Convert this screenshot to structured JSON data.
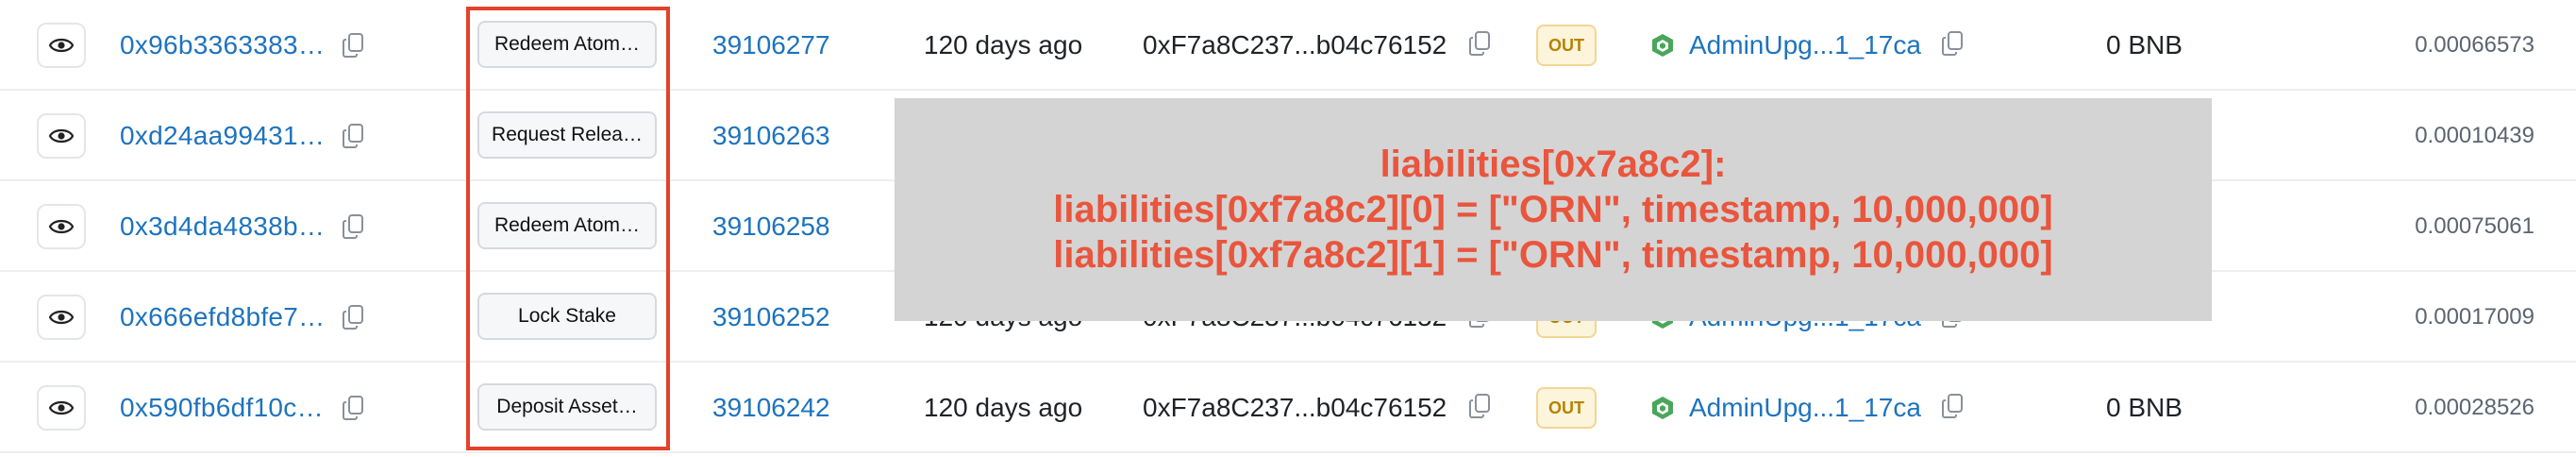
{
  "rows": [
    {
      "hash": "0x96b3363383…",
      "method": "Redeem Atom…",
      "block": "39106277",
      "age": "120 days ago",
      "from": "0xF7a8C237...b04c76152",
      "direction": "OUT",
      "to": "AdminUpg...1_17ca",
      "value": "0 BNB",
      "fee": "0.00066573"
    },
    {
      "hash": "0xd24aa99431…",
      "method": "Request Relea…",
      "block": "39106263",
      "age": "",
      "from": "",
      "direction": "",
      "to": "",
      "value": "",
      "fee": "0.00010439"
    },
    {
      "hash": "0x3d4da4838b…",
      "method": "Redeem Atom…",
      "block": "39106258",
      "age": "",
      "from": "",
      "direction": "",
      "to": "",
      "value": "",
      "fee": "0.00075061"
    },
    {
      "hash": "0x666efd8bfe7…",
      "method": "Lock Stake",
      "block": "39106252",
      "age": "120 days ago",
      "from": "0xF7a8C237...b04c76152",
      "direction": "OUT",
      "to": "AdminUpg...1_17ca",
      "value": "",
      "fee": "0.00017009"
    },
    {
      "hash": "0x590fb6df10c…",
      "method": "Deposit Asset…",
      "block": "39106242",
      "age": "120 days ago",
      "from": "0xF7a8C237...b04c76152",
      "direction": "OUT",
      "to": "AdminUpg...1_17ca",
      "value": "0 BNB",
      "fee": "0.00028526"
    }
  ],
  "overlay": {
    "line1": "liabilities[0x7a8c2]:",
    "line2": "liabilities[0xf7a8c2][0] = [\"ORN\", timestamp, 10,000,000]",
    "line3": "liabilities[0xf7a8c2][1] = [\"ORN\", timestamp, 10,000,000]"
  },
  "icons": {
    "view": "eye-icon",
    "copy": "copy-icon",
    "contract": "contract-icon"
  },
  "colors": {
    "link": "#1e73be",
    "annotation": "#e9553d",
    "highlight_border": "#e4412c",
    "badge_bg": "#fdf4dc",
    "badge_text": "#b58300",
    "overlay_bg": "#d4d4d4"
  }
}
